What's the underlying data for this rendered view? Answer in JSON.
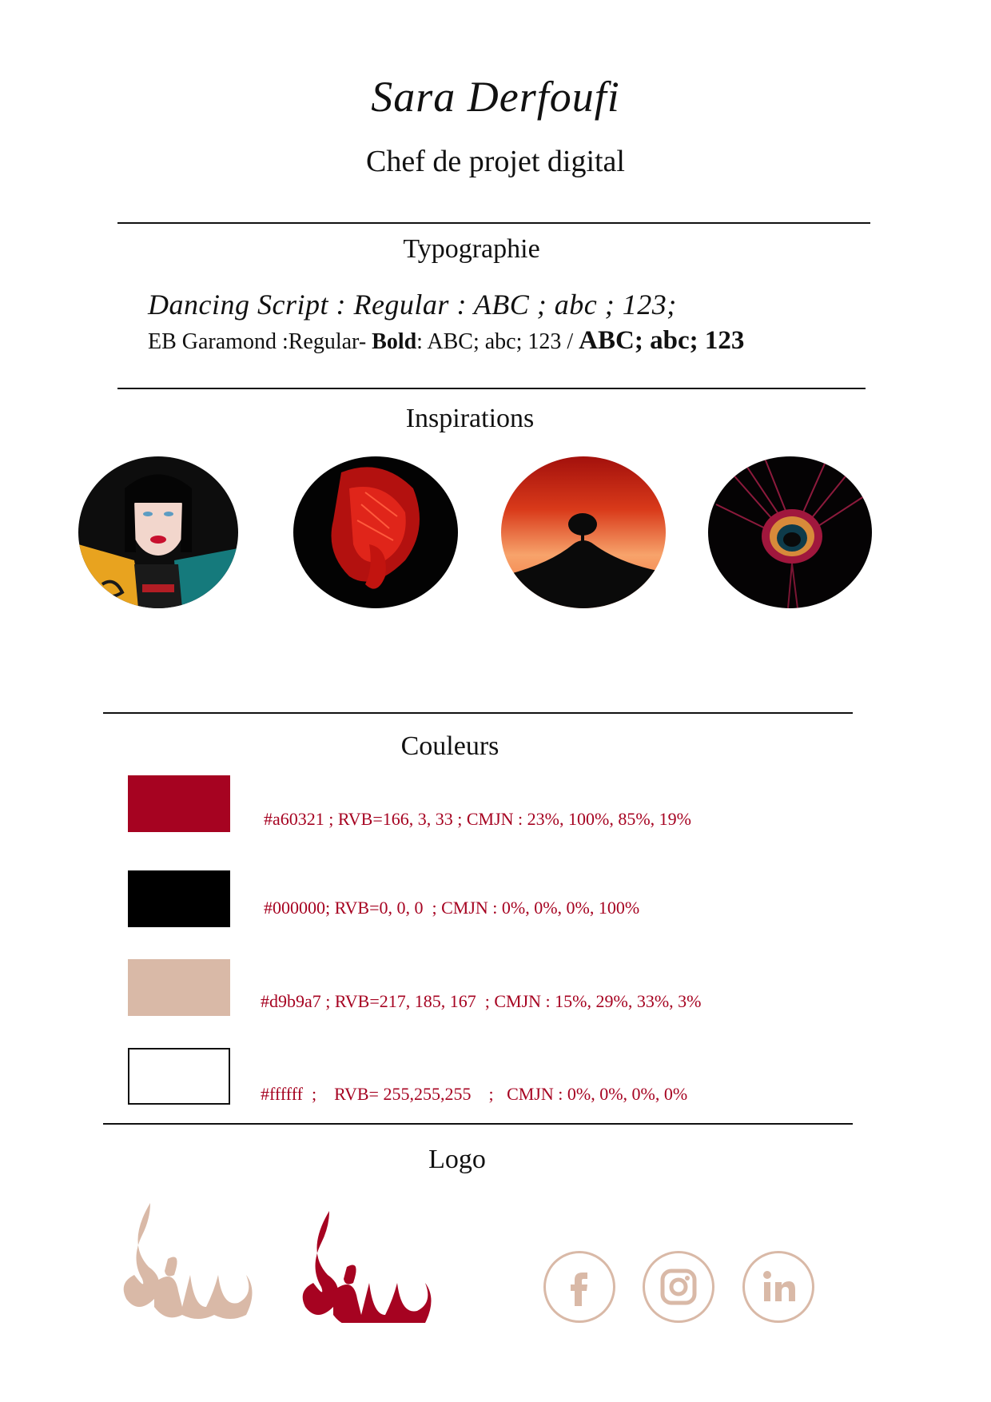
{
  "header": {
    "name": "Sara Derfoufi",
    "role": "Chef de projet digital"
  },
  "typography": {
    "heading": "Typographie",
    "script_sample": "Dancing Script : Regular : ABC ; abc ; 123;",
    "garamond_prefix": "EB Garamond :Regular- ",
    "garamond_bold_word": "Bold",
    "garamond_middle": ": ABC; abc; 123 / ",
    "garamond_bold_sample": "ABC; abc; 123"
  },
  "inspirations": {
    "heading": "Inspirations",
    "images": [
      {
        "icon": "woman-portrait-image"
      },
      {
        "icon": "red-betta-fish-image"
      },
      {
        "icon": "sunset-tree-image"
      },
      {
        "icon": "peacock-feather-image"
      }
    ]
  },
  "colors": {
    "heading": "Couleurs",
    "swatches": [
      {
        "hex": "#a60321",
        "label": "#a60321 ; RVB=166, 3, 33 ; CMJN : 23%, 100%, 85%, 19%"
      },
      {
        "hex": "#000000",
        "label": "#000000; RVB=0, 0, 0  ; CMJN : 0%, 0%, 0%, 100%"
      },
      {
        "hex": "#d9b9a7",
        "label": "#d9b9a7 ; RVB=217, 185, 167  ; CMJN : 15%, 29%, 33%, 3%"
      },
      {
        "hex": "#ffffff",
        "label": "#ffffff  ;    RVB= 255,255,255    ;   CMJN : 0%, 0%, 0%, 0%"
      }
    ]
  },
  "logo": {
    "heading": "Logo",
    "marks": [
      {
        "icon": "flame-logo-icon",
        "color": "#d9b9a7"
      },
      {
        "icon": "flame-logo-icon",
        "color": "#a60321"
      }
    ],
    "social": [
      {
        "icon": "facebook-icon",
        "glyph": "f"
      },
      {
        "icon": "instagram-icon"
      },
      {
        "icon": "linkedin-icon",
        "glyph": "in"
      }
    ]
  }
}
